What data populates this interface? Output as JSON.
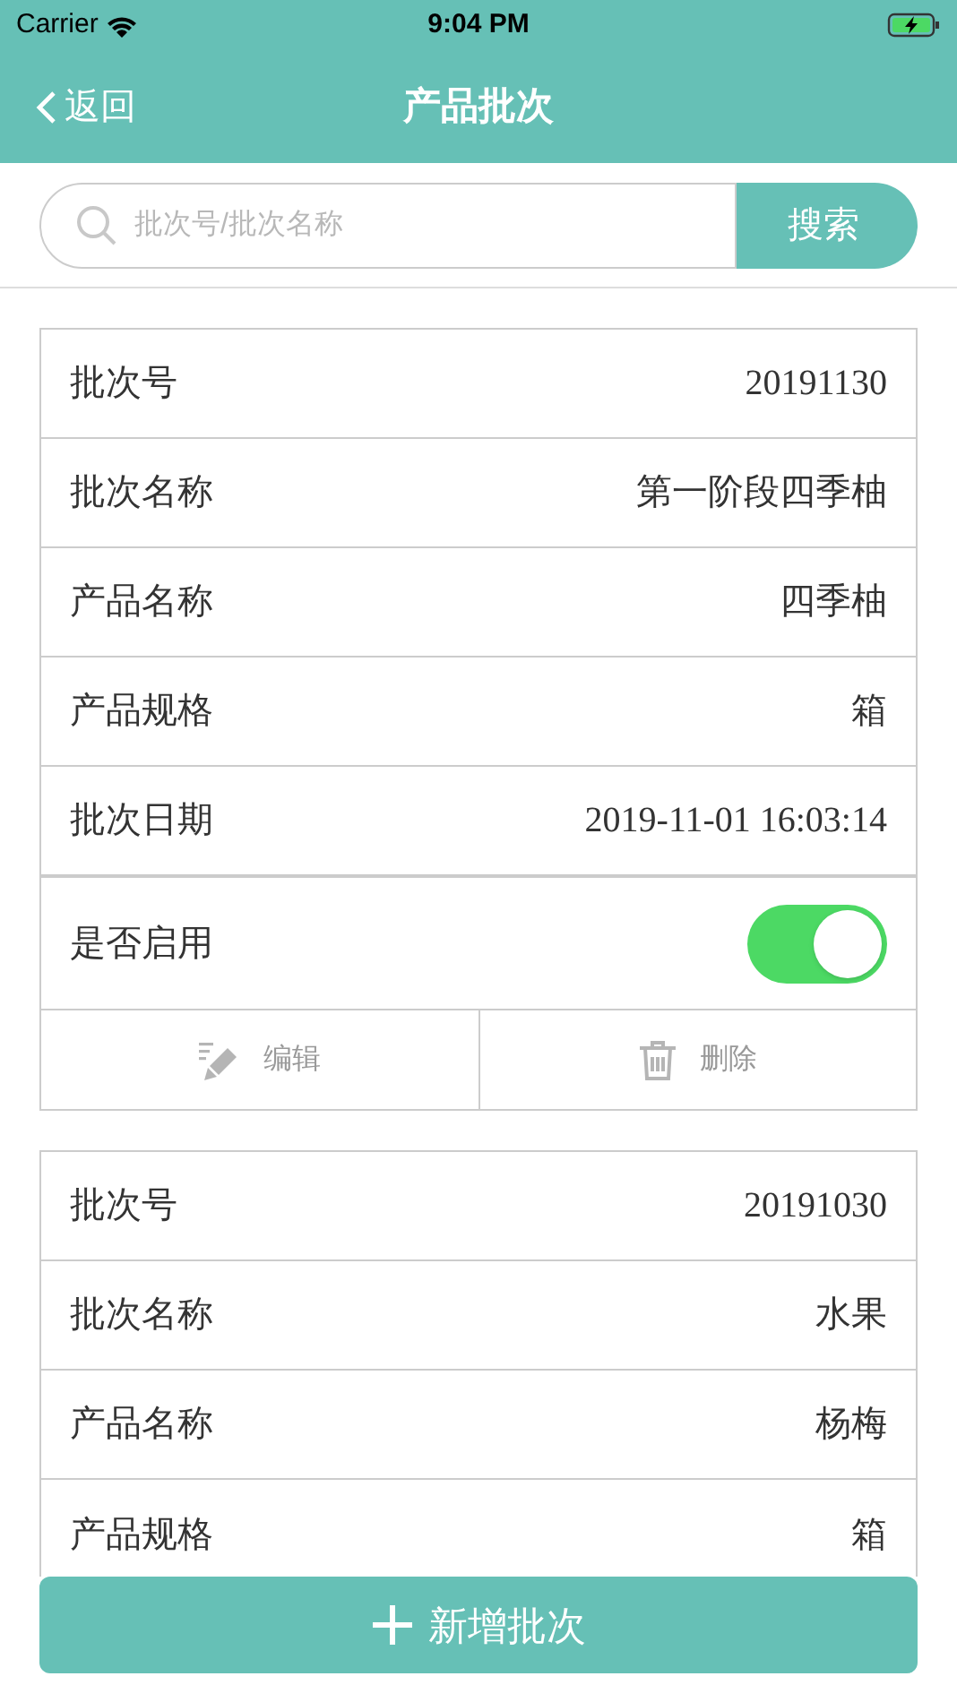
{
  "status_bar": {
    "carrier": "Carrier",
    "time": "9:04 PM"
  },
  "nav": {
    "back": "返回",
    "title": "产品批次"
  },
  "search": {
    "placeholder": "批次号/批次名称",
    "button": "搜索"
  },
  "batches": [
    {
      "fields": [
        {
          "label": "批次号",
          "value": "20191130"
        },
        {
          "label": "批次名称",
          "value": "第一阶段四季柚"
        },
        {
          "label": "产品名称",
          "value": "四季柚"
        },
        {
          "label": "产品规格",
          "value": "箱"
        },
        {
          "label": "批次日期",
          "value": "2019-11-01 16:03:14"
        }
      ],
      "enabled_label": "是否启用",
      "enabled": true,
      "actions": [
        {
          "kind": "edit",
          "label": "编辑"
        },
        {
          "kind": "delete",
          "label": "删除"
        }
      ]
    },
    {
      "fields": [
        {
          "label": "批次号",
          "value": "20191030"
        },
        {
          "label": "批次名称",
          "value": "水果"
        },
        {
          "label": "产品名称",
          "value": "杨梅"
        },
        {
          "label": "产品规格",
          "value": "箱"
        }
      ]
    }
  ],
  "add_button": "新增批次"
}
